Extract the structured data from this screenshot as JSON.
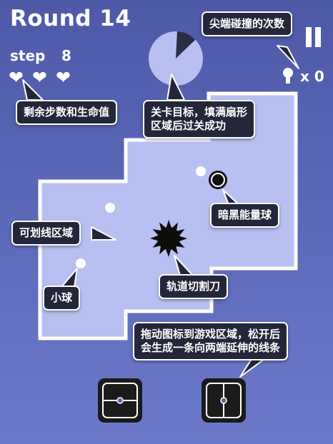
{
  "hud": {
    "round_title": "Round 14",
    "step_label": "step",
    "step_value": "8",
    "lives": 3,
    "lives_icon": "heart-icon",
    "collision_count": "x 0",
    "pause_icon": "pause-icon",
    "pie_progress": 0.12
  },
  "callouts": {
    "collision": "尖端碰撞的次数",
    "target_line1": "关卡目标，填满扇形",
    "target_line2": "区域后过关成功",
    "remaining": "剩余步数和生命值",
    "dark_ball": "暗黑能量球",
    "drawable_area": "可划线区域",
    "small_ball": "小球",
    "saw": "轨道切割刀",
    "drag_line1": "拖动图标到游戏区域，松开后",
    "drag_line2": "会生成一条向两端延伸的线条"
  },
  "colors": {
    "background": "#5563b0",
    "play_area": "#b8c0f2",
    "border": "#ffffff",
    "pie_fill": "#b8c0f2",
    "pie_slice": "#2b2d45",
    "callout_bg": "#24263a"
  },
  "tools": [
    {
      "name": "horizontal-line-tool",
      "orientation": "horizontal"
    },
    {
      "name": "vertical-line-tool",
      "orientation": "vertical"
    }
  ]
}
